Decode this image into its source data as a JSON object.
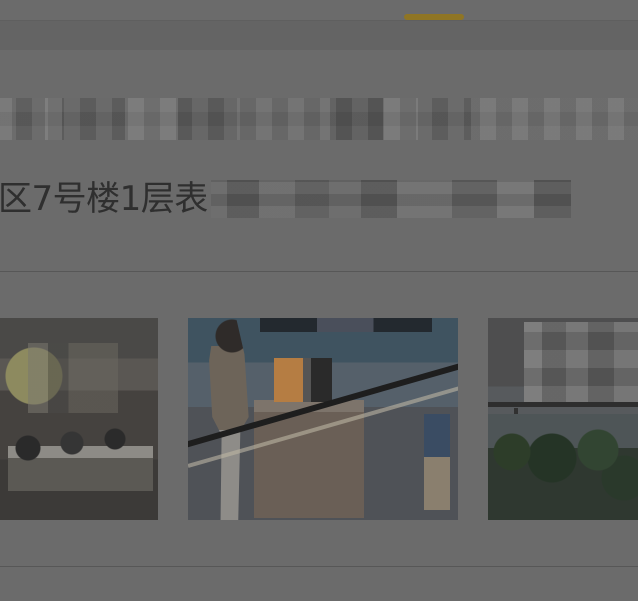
{
  "header": {
    "active_tab_color": "#8f7524"
  },
  "location": {
    "address_visible_text": "区7号楼1层表"
  },
  "gallery": {
    "items": [
      {
        "name": "restaurant-dining-photo"
      },
      {
        "name": "service-counter-photo"
      },
      {
        "name": "window-view-photo"
      }
    ]
  }
}
